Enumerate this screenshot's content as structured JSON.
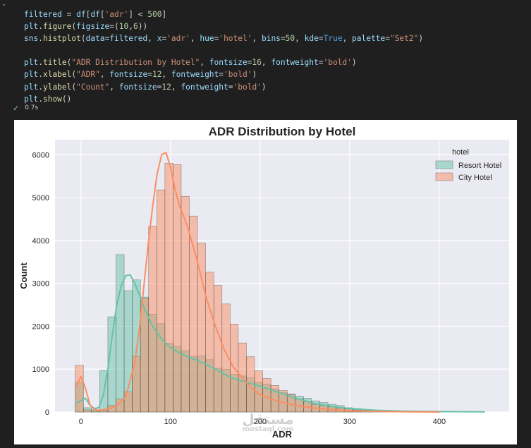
{
  "cell": {
    "code_lines": [
      "filtered = df[df['adr'] < 500]",
      "plt.figure(figsize=(10,6))",
      "sns.histplot(data=filtered, x='adr', hue='hotel', bins=50, kde=True, palette=\"Set2\")",
      "",
      "plt.title(\"ADR Distribution by Hotel\", fontsize=16, fontweight='bold')",
      "plt.xlabel(\"ADR\", fontsize=12, fontweight='bold')",
      "plt.ylabel(\"Count\", fontsize=12, fontweight='bold')",
      "plt.show()"
    ],
    "run_time": "0.7s",
    "status_icon": "check-icon"
  },
  "watermark": {
    "arabic": "مستقل",
    "latin": "mostaql.com"
  },
  "chart_data": {
    "type": "histogram",
    "title": "ADR Distribution by Hotel",
    "xlabel": "ADR",
    "ylabel": "Count",
    "xlim": [
      -29,
      478
    ],
    "ylim": [
      0,
      6350
    ],
    "xticks": [
      0,
      100,
      200,
      300,
      400
    ],
    "yticks": [
      0,
      1000,
      2000,
      3000,
      4000,
      5000,
      6000
    ],
    "grid": true,
    "legend": {
      "title": "hotel",
      "placement": "top-right"
    },
    "bin_edges": [
      -6.4,
      2.7,
      11.8,
      20.9,
      30.0,
      39.1,
      48.2,
      57.3,
      66.4,
      75.5,
      84.6,
      93.7,
      102.8,
      111.9,
      121.0,
      130.1,
      139.2,
      148.3,
      157.4,
      166.5,
      175.6,
      184.7,
      193.8,
      202.9,
      212.0,
      221.1,
      230.2,
      239.3,
      248.4,
      257.5,
      266.6,
      275.7,
      284.8,
      293.9,
      303.0,
      312.1,
      321.2,
      330.3,
      339.4,
      348.5,
      357.6,
      366.7,
      375.8,
      384.9,
      394.0,
      403.1,
      412.2,
      421.3,
      430.4,
      439.5,
      451.0
    ],
    "series": [
      {
        "name": "Resort Hotel",
        "color": "#66c2a5",
        "bin_counts": [
          700,
          100,
          50,
          970,
          2220,
          3670,
          2830,
          3080,
          2680,
          2280,
          2060,
          1600,
          1530,
          1430,
          1300,
          1310,
          1220,
          1020,
          1000,
          880,
          840,
          800,
          690,
          650,
          540,
          460,
          420,
          370,
          320,
          260,
          220,
          180,
          150,
          100,
          80,
          60,
          50,
          35,
          30,
          25,
          20,
          15,
          12,
          10,
          8,
          6,
          5,
          4,
          3,
          2
        ],
        "kde_x": [
          -5,
          0,
          5,
          10,
          15,
          20,
          25,
          30,
          35,
          40,
          45,
          50,
          55,
          60,
          65,
          70,
          80,
          90,
          100,
          110,
          120,
          130,
          140,
          150,
          160,
          170,
          180,
          200,
          220,
          240,
          260,
          280,
          300,
          330,
          360,
          400,
          450
        ],
        "kde_y": [
          200,
          270,
          320,
          160,
          80,
          100,
          400,
          1000,
          1800,
          2500,
          2950,
          3180,
          3200,
          3000,
          2750,
          2450,
          2000,
          1700,
          1500,
          1380,
          1280,
          1200,
          1100,
          1000,
          880,
          780,
          720,
          600,
          460,
          320,
          200,
          130,
          80,
          40,
          20,
          10,
          5
        ]
      },
      {
        "name": "City Hotel",
        "color": "#fc8d62",
        "bin_counts": [
          1090,
          50,
          20,
          30,
          150,
          300,
          470,
          1300,
          2650,
          4330,
          5180,
          5800,
          5770,
          5030,
          4570,
          3940,
          3260,
          2950,
          2520,
          2050,
          1610,
          1290,
          960,
          780,
          620,
          500,
          410,
          300,
          240,
          180,
          150,
          120,
          90,
          70,
          50,
          40,
          30,
          25,
          20,
          15,
          12,
          10,
          8,
          6,
          5,
          4,
          3,
          2,
          2,
          1
        ],
        "kde_x": [
          -5,
          0,
          5,
          10,
          15,
          20,
          30,
          40,
          50,
          60,
          65,
          70,
          75,
          80,
          85,
          90,
          95,
          100,
          105,
          110,
          115,
          120,
          130,
          140,
          150,
          160,
          170,
          180,
          190,
          200,
          220,
          240,
          260,
          280,
          300,
          330,
          360,
          400
        ],
        "kde_y": [
          600,
          830,
          560,
          170,
          60,
          40,
          70,
          150,
          350,
          1150,
          1900,
          2900,
          3900,
          4800,
          5550,
          6000,
          6050,
          5700,
          5200,
          4800,
          4550,
          4250,
          3500,
          2650,
          2000,
          1450,
          1050,
          800,
          560,
          400,
          250,
          150,
          90,
          55,
          30,
          15,
          6,
          0
        ]
      }
    ]
  }
}
